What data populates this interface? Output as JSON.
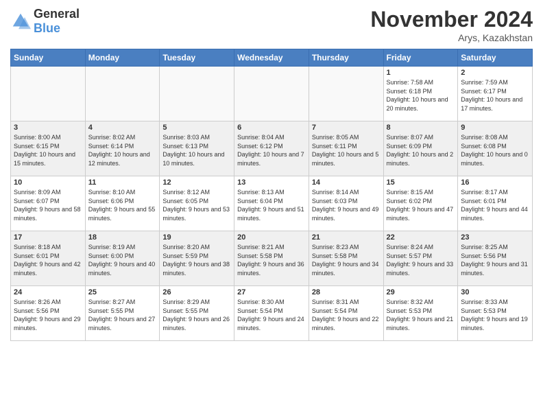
{
  "header": {
    "logo_general": "General",
    "logo_blue": "Blue",
    "month_title": "November 2024",
    "location": "Arys, Kazakhstan"
  },
  "columns": [
    "Sunday",
    "Monday",
    "Tuesday",
    "Wednesday",
    "Thursday",
    "Friday",
    "Saturday"
  ],
  "weeks": [
    [
      {
        "day": "",
        "info": "",
        "empty": true
      },
      {
        "day": "",
        "info": "",
        "empty": true
      },
      {
        "day": "",
        "info": "",
        "empty": true
      },
      {
        "day": "",
        "info": "",
        "empty": true
      },
      {
        "day": "",
        "info": "",
        "empty": true
      },
      {
        "day": "1",
        "info": "Sunrise: 7:58 AM\nSunset: 6:18 PM\nDaylight: 10 hours and 20 minutes.",
        "empty": false
      },
      {
        "day": "2",
        "info": "Sunrise: 7:59 AM\nSunset: 6:17 PM\nDaylight: 10 hours and 17 minutes.",
        "empty": false
      }
    ],
    [
      {
        "day": "3",
        "info": "Sunrise: 8:00 AM\nSunset: 6:15 PM\nDaylight: 10 hours and 15 minutes.",
        "empty": false
      },
      {
        "day": "4",
        "info": "Sunrise: 8:02 AM\nSunset: 6:14 PM\nDaylight: 10 hours and 12 minutes.",
        "empty": false
      },
      {
        "day": "5",
        "info": "Sunrise: 8:03 AM\nSunset: 6:13 PM\nDaylight: 10 hours and 10 minutes.",
        "empty": false
      },
      {
        "day": "6",
        "info": "Sunrise: 8:04 AM\nSunset: 6:12 PM\nDaylight: 10 hours and 7 minutes.",
        "empty": false
      },
      {
        "day": "7",
        "info": "Sunrise: 8:05 AM\nSunset: 6:11 PM\nDaylight: 10 hours and 5 minutes.",
        "empty": false
      },
      {
        "day": "8",
        "info": "Sunrise: 8:07 AM\nSunset: 6:09 PM\nDaylight: 10 hours and 2 minutes.",
        "empty": false
      },
      {
        "day": "9",
        "info": "Sunrise: 8:08 AM\nSunset: 6:08 PM\nDaylight: 10 hours and 0 minutes.",
        "empty": false
      }
    ],
    [
      {
        "day": "10",
        "info": "Sunrise: 8:09 AM\nSunset: 6:07 PM\nDaylight: 9 hours and 58 minutes.",
        "empty": false
      },
      {
        "day": "11",
        "info": "Sunrise: 8:10 AM\nSunset: 6:06 PM\nDaylight: 9 hours and 55 minutes.",
        "empty": false
      },
      {
        "day": "12",
        "info": "Sunrise: 8:12 AM\nSunset: 6:05 PM\nDaylight: 9 hours and 53 minutes.",
        "empty": false
      },
      {
        "day": "13",
        "info": "Sunrise: 8:13 AM\nSunset: 6:04 PM\nDaylight: 9 hours and 51 minutes.",
        "empty": false
      },
      {
        "day": "14",
        "info": "Sunrise: 8:14 AM\nSunset: 6:03 PM\nDaylight: 9 hours and 49 minutes.",
        "empty": false
      },
      {
        "day": "15",
        "info": "Sunrise: 8:15 AM\nSunset: 6:02 PM\nDaylight: 9 hours and 47 minutes.",
        "empty": false
      },
      {
        "day": "16",
        "info": "Sunrise: 8:17 AM\nSunset: 6:01 PM\nDaylight: 9 hours and 44 minutes.",
        "empty": false
      }
    ],
    [
      {
        "day": "17",
        "info": "Sunrise: 8:18 AM\nSunset: 6:01 PM\nDaylight: 9 hours and 42 minutes.",
        "empty": false
      },
      {
        "day": "18",
        "info": "Sunrise: 8:19 AM\nSunset: 6:00 PM\nDaylight: 9 hours and 40 minutes.",
        "empty": false
      },
      {
        "day": "19",
        "info": "Sunrise: 8:20 AM\nSunset: 5:59 PM\nDaylight: 9 hours and 38 minutes.",
        "empty": false
      },
      {
        "day": "20",
        "info": "Sunrise: 8:21 AM\nSunset: 5:58 PM\nDaylight: 9 hours and 36 minutes.",
        "empty": false
      },
      {
        "day": "21",
        "info": "Sunrise: 8:23 AM\nSunset: 5:58 PM\nDaylight: 9 hours and 34 minutes.",
        "empty": false
      },
      {
        "day": "22",
        "info": "Sunrise: 8:24 AM\nSunset: 5:57 PM\nDaylight: 9 hours and 33 minutes.",
        "empty": false
      },
      {
        "day": "23",
        "info": "Sunrise: 8:25 AM\nSunset: 5:56 PM\nDaylight: 9 hours and 31 minutes.",
        "empty": false
      }
    ],
    [
      {
        "day": "24",
        "info": "Sunrise: 8:26 AM\nSunset: 5:56 PM\nDaylight: 9 hours and 29 minutes.",
        "empty": false
      },
      {
        "day": "25",
        "info": "Sunrise: 8:27 AM\nSunset: 5:55 PM\nDaylight: 9 hours and 27 minutes.",
        "empty": false
      },
      {
        "day": "26",
        "info": "Sunrise: 8:29 AM\nSunset: 5:55 PM\nDaylight: 9 hours and 26 minutes.",
        "empty": false
      },
      {
        "day": "27",
        "info": "Sunrise: 8:30 AM\nSunset: 5:54 PM\nDaylight: 9 hours and 24 minutes.",
        "empty": false
      },
      {
        "day": "28",
        "info": "Sunrise: 8:31 AM\nSunset: 5:54 PM\nDaylight: 9 hours and 22 minutes.",
        "empty": false
      },
      {
        "day": "29",
        "info": "Sunrise: 8:32 AM\nSunset: 5:53 PM\nDaylight: 9 hours and 21 minutes.",
        "empty": false
      },
      {
        "day": "30",
        "info": "Sunrise: 8:33 AM\nSunset: 5:53 PM\nDaylight: 9 hours and 19 minutes.",
        "empty": false
      }
    ]
  ]
}
